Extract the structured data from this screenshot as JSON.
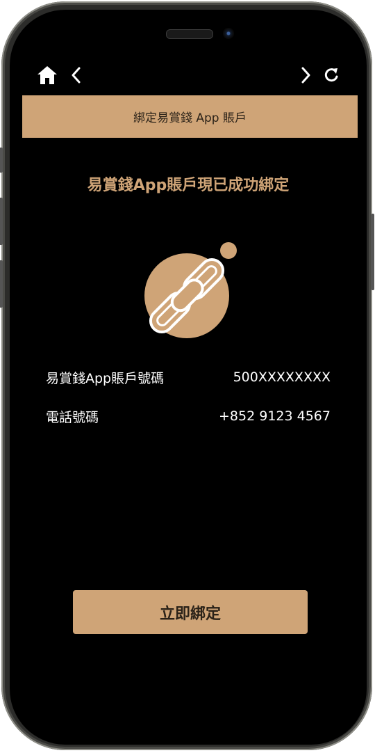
{
  "header": {
    "title": "綁定易賞錢 App 賬戶"
  },
  "nav": {
    "home_icon": "home-icon",
    "back_icon": "chevron-left-icon",
    "forward_icon": "chevron-right-icon",
    "refresh_icon": "refresh-icon"
  },
  "main": {
    "headline": "易賞錢App賬戶現已成功綁定",
    "illustration_icon": "link-chain-icon",
    "rows": [
      {
        "label": "易賞錢App賬戶號碼",
        "value": "500XXXXXXXX"
      },
      {
        "label": "電話號碼",
        "value": "+852 9123 4567"
      }
    ]
  },
  "action": {
    "label": "立即綁定"
  },
  "colors": {
    "accent": "#cfa477",
    "background": "#000000",
    "text": "#ffffff"
  }
}
